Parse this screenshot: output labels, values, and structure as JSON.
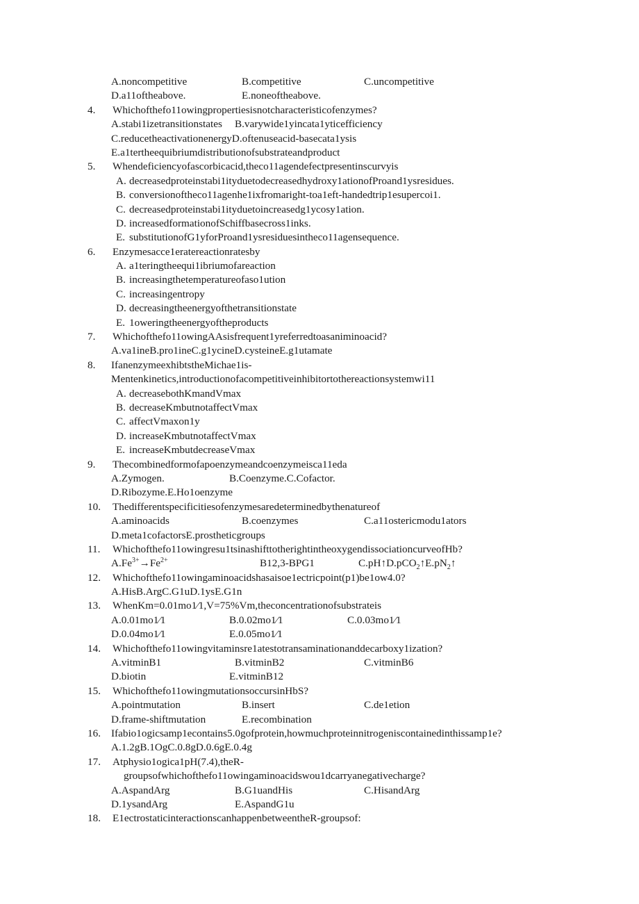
{
  "page": {
    "background": "#ffffff",
    "text_color": "#1a1a1a"
  },
  "q3_options": {
    "a": "A.noncompetitive",
    "b": "B.competitive",
    "c": "C.uncompetitive",
    "d": "D.a11ofcheabove.",
    "d_text": "D.a11oftheabove.",
    "e": "E.noneoftheabove."
  },
  "q4": {
    "num": "4.",
    "stem": "Whichofthefo11owingpropertiesisnotcharacteristicofenzymes?",
    "a": "A.stabi1izetransitionstates",
    "b": "B.varywide1yincata1yticefficiency",
    "cd": "C.reducetheactivationenergyD.oftenuseacid-basecata1ysis",
    "e": "E.a1tertheequibriumdistributionofsubstrateandproduct"
  },
  "q5": {
    "num": "5.",
    "stem": "Whendeficiencyofascorbicacid,theco11agendefectpresentinscurvyis",
    "options": [
      {
        "letter": "A.",
        "text": "decreasedproteinstabi1ityduetodecreasedhydroxy1ationofProand1ysresidues."
      },
      {
        "letter": "B.",
        "text": "conversionoftheco11agenhe1ixfromaright-toa1eft-handedtrip1esupercoi1."
      },
      {
        "letter": "C.",
        "text": "decreasedproteinstabi1ityduetoincreasedg1ycosy1ation."
      },
      {
        "letter": "D.",
        "text": "increasedformationofSchiffbasecross1inks."
      },
      {
        "letter": "E.",
        "text": "substitutionofG1yforProand1ysresiduesintheco11agensequence."
      }
    ]
  },
  "q6": {
    "num": "6.",
    "stem": "Enzymesacce1eratereactionratesby",
    "options": [
      {
        "letter": "A.",
        "text": "a1teringtheequi1ibriumofareaction"
      },
      {
        "letter": "B.",
        "text": "increasingthetemperatureofaso1ution"
      },
      {
        "letter": "C.",
        "text": "increasingentropy"
      },
      {
        "letter": "D.",
        "text": "decreasingtheenergyofthetransitionstate"
      },
      {
        "letter": "E.",
        "text": "1oweringtheenergyoftheproducts"
      }
    ]
  },
  "q7": {
    "num": "7.",
    "stem": "Whichothefo11owingAAsisfrequent1yreferredtoasaniminoacid?",
    "stem_text": "Whichofthefo11owingAAsisfrequent1yreferredtoasaniminoacid?",
    "options_line": "A.va1ineB.pro1ineC.g1ycineD.cysteineE.g1utamate"
  },
  "q8": {
    "num": "8.",
    "stem_line1": "IfanenzymeexhibtstheMichae1is-",
    "stem_line2": "Mentenkinetics,introductionofacompetitiveinhibitortothereactionsystemwi11",
    "options": [
      {
        "letter": "A.",
        "text": "decreasebothKmandVmax"
      },
      {
        "letter": "B.",
        "text": "decreaseKmbutnotaffectVmax"
      },
      {
        "letter": "C.",
        "text": "affectVmaxon1y"
      },
      {
        "letter": "D.",
        "text": "increaseKmbutnotaffectVmax"
      },
      {
        "letter": "E.",
        "text": "increaseKmbutdecreaseVmax"
      }
    ]
  },
  "q9": {
    "num": "9.",
    "stem": "Thecombinedformofapoenzymeandcoenzymeisca11eda",
    "a": "A.Zymogen.",
    "bc": "B.Coenzyme.C.Cofactor.",
    "de": "D.Ribozyme.E.Ho1oenzyme"
  },
  "q10": {
    "num": "10.",
    "stem": "Thedifferentspecificitiesofenzymesaredeterminedbythenatureof",
    "a": "A.aminoacids",
    "b": "B.coenzymes",
    "c": "C.a11ostericmodu1ators",
    "de": "D.meta1cofactorsE.prostheticgroups"
  },
  "q11": {
    "num": "11.",
    "stem": "Whichofthefo11owingresu1tsinashifttotherightintheoxygendissociationcurveofHb?",
    "a_prefix": "A.Fe",
    "a_sup1": "3+",
    "a_arrow": "→Fe",
    "a_sup2": "2+",
    "b": "B12,3-BPG1",
    "c_prefix": "C.pH↑D.pCO",
    "c_sub1": "2",
    "c_mid": "↑E.pN",
    "c_sub2": "2",
    "c_suffix": "↑"
  },
  "q12": {
    "num": "12.",
    "stem": "Whichofthefo11owingaminoacidshasaisoe1ectricpoint(p1)be1ow4.0?",
    "options_line": "A.HisB.ArgC.G1uD.1ysE.G1n"
  },
  "q13": {
    "num": "13.",
    "stem": "WhenKm=0.01mo1⁄1,V=75%Vm,theconcentrationofsubstrateis",
    "a": "A.0.01mo1⁄1",
    "b": "B.0.02mo1⁄1",
    "c": "C.0.03mo1⁄1",
    "d": "D.0.04mo1⁄1",
    "e": "E.0.05mo1⁄1"
  },
  "q14": {
    "num": "14.",
    "stem": "Whichofthefo11owingvitaminsre1atestotransaminationanddecarboxy1ization?",
    "a": "A.vitminB1",
    "b": "B.vitminB2",
    "c": "C.vitminB6",
    "d": "D.biotin",
    "e": "E.vitminB12"
  },
  "q15": {
    "num": "15.",
    "stem": "Whichofthefo11owingmutationsoccursinHbS?",
    "a": "A.pointmutation",
    "b": "B.insert",
    "c": "C.de1etion",
    "d": "D.frame-shiftmutation",
    "e": "E.recombination"
  },
  "q16": {
    "num": "16.",
    "stem": "Ifabio1ogicsamp1econtains5.0gofprotein,howmuchproteinnitrogeniscontainedinthissamp1e?",
    "options_line": "A.1.2gB.1OgC.0.8gD.0.6gE.0.4g"
  },
  "q17": {
    "num": "17.",
    "stem_line1": "Atphysio1ogica1pH(7.4),theR-",
    "stem_line2": "groupsofwhichofthefo11owingaminoacidswou1dcarryanegativecharge?",
    "a": "A.AspandArg",
    "b": "B.G1uandHis",
    "c": "C.HisandArg",
    "d": "D.1ysandArg",
    "e": "E.AspandG1u"
  },
  "q18": {
    "num": "18.",
    "stem": "E1ectrostaticinteractionscanhappenbetweentheR-groupsof:"
  }
}
